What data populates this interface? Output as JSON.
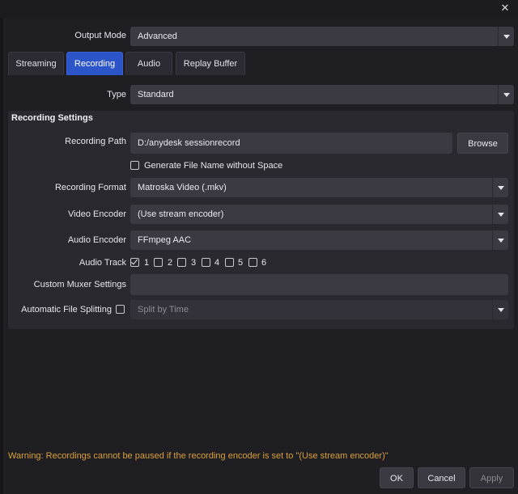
{
  "window": {
    "close_glyph": "✕"
  },
  "output_mode": {
    "label": "Output Mode",
    "value": "Advanced"
  },
  "tabs": [
    {
      "label": "Streaming",
      "active": false
    },
    {
      "label": "Recording",
      "active": true
    },
    {
      "label": "Audio",
      "active": false
    },
    {
      "label": "Replay Buffer",
      "active": false
    }
  ],
  "type_row": {
    "label": "Type",
    "value": "Standard"
  },
  "recording_settings": {
    "title": "Recording Settings",
    "path": {
      "label": "Recording Path",
      "value": "D:/anydesk sessionrecord",
      "browse_label": "Browse"
    },
    "no_space": {
      "label": "Generate File Name without Space",
      "checked": false
    },
    "format": {
      "label": "Recording Format",
      "value": "Matroska Video (.mkv)"
    },
    "video_encoder": {
      "label": "Video Encoder",
      "value": "(Use stream encoder)"
    },
    "audio_encoder": {
      "label": "Audio Encoder",
      "value": "FFmpeg AAC"
    },
    "audio_track": {
      "label": "Audio Track",
      "tracks": [
        {
          "label": "1",
          "checked": true
        },
        {
          "label": "2",
          "checked": false
        },
        {
          "label": "3",
          "checked": false
        },
        {
          "label": "4",
          "checked": false
        },
        {
          "label": "5",
          "checked": false
        },
        {
          "label": "6",
          "checked": false
        }
      ]
    },
    "custom_muxer": {
      "label": "Custom Muxer Settings",
      "value": ""
    },
    "file_splitting": {
      "label": "Automatic File Splitting",
      "checked": false,
      "value": "Split by Time"
    }
  },
  "warning": "Warning: Recordings cannot be paused if the recording encoder is set to \"(Use stream encoder)\"",
  "buttons": {
    "ok": "OK",
    "cancel": "Cancel",
    "apply": "Apply"
  },
  "colors": {
    "accent": "#2b55c8",
    "warning": "#d9a13a",
    "background": "#1f1e23"
  }
}
